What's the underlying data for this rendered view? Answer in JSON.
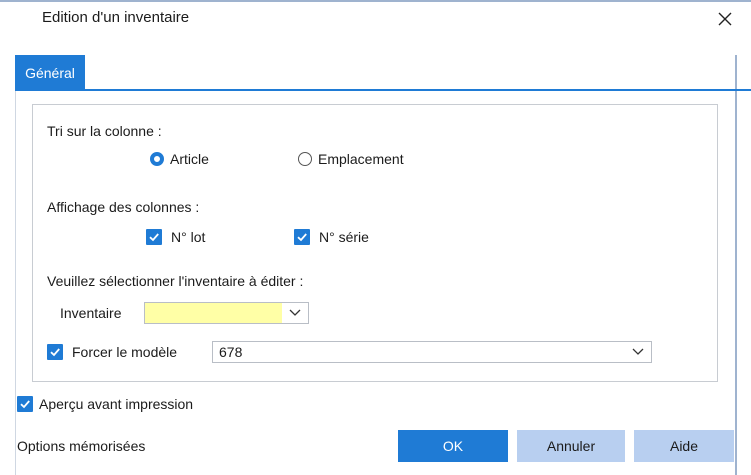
{
  "window": {
    "title": "Edition d'un inventaire"
  },
  "tabs": [
    {
      "label": "Général"
    }
  ],
  "sort": {
    "label": "Tri sur la colonne :",
    "options": [
      {
        "label": "Article",
        "selected": true
      },
      {
        "label": "Emplacement",
        "selected": false
      }
    ]
  },
  "columns": {
    "label": "Affichage des colonnes :",
    "options": [
      {
        "label": "N° lot",
        "checked": true
      },
      {
        "label": "N° série",
        "checked": true
      }
    ]
  },
  "inventory": {
    "prompt": "Veuillez sélectionner l'inventaire à éditer :",
    "field_label": "Inventaire",
    "field_value": "",
    "force_label": "Forcer le modèle",
    "force_checked": true,
    "model_value": "678"
  },
  "preview": {
    "label": "Aperçu avant impression",
    "checked": true
  },
  "footer": {
    "options_label": "Options mémorisées",
    "ok": "OK",
    "cancel": "Annuler",
    "help": "Aide"
  },
  "colors": {
    "accent": "#1f7bd5",
    "secondary_button": "#b8cff0",
    "highlight_field": "#ffffa6"
  },
  "icons": {
    "close": "close-icon",
    "check": "checkmark-icon",
    "dropdown": "chevron-down-icon"
  }
}
